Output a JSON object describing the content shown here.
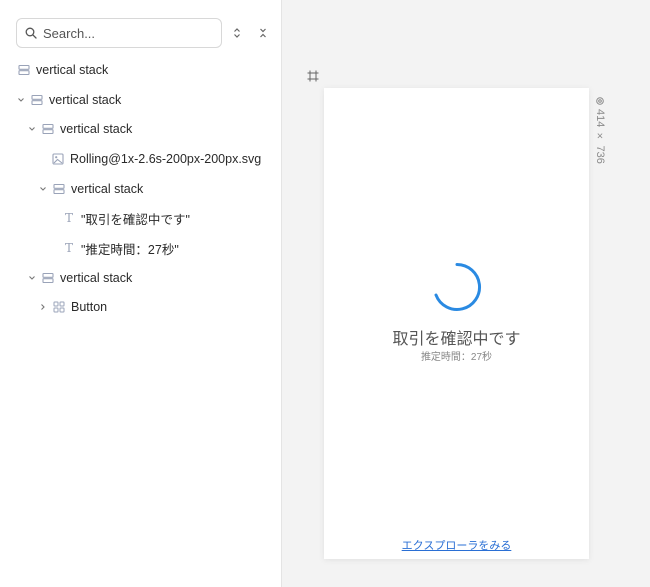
{
  "search": {
    "placeholder": "Search..."
  },
  "toolbar": {
    "expand_icon": "chevron-up-down-icon",
    "collapse_icon": "collapse-icon"
  },
  "tree": [
    {
      "label": "vertical stack",
      "icon": "stack-icon",
      "chevron": "none"
    },
    {
      "label": "vertical stack",
      "icon": "stack-icon",
      "chevron": "down"
    },
    {
      "label": "vertical stack",
      "icon": "stack-icon",
      "chevron": "down"
    },
    {
      "label": "Rolling@1x-2.6s-200px-200px.svg",
      "icon": "image-icon",
      "chevron": "none"
    },
    {
      "label": "vertical stack",
      "icon": "stack-icon",
      "chevron": "down"
    },
    {
      "label": "\"取引を確認中です\"",
      "icon": "text-icon",
      "chevron": "none"
    },
    {
      "label": "\"推定時間：27秒\"",
      "icon": "text-icon",
      "chevron": "none"
    },
    {
      "label": "vertical stack",
      "icon": "stack-icon",
      "chevron": "down"
    },
    {
      "label": "Button",
      "icon": "component-icon",
      "chevron": "right"
    }
  ],
  "canvas": {
    "size_label": "414 × 736",
    "spinner_color": "#2a8ae2",
    "title": "取引を確認中です",
    "subtitle": "推定時間：27秒",
    "link": "エクスプローラをみる"
  },
  "colors": {
    "accent": "#2a8ae2",
    "link": "#2a6fd4",
    "icon": "#9aa3b8"
  }
}
